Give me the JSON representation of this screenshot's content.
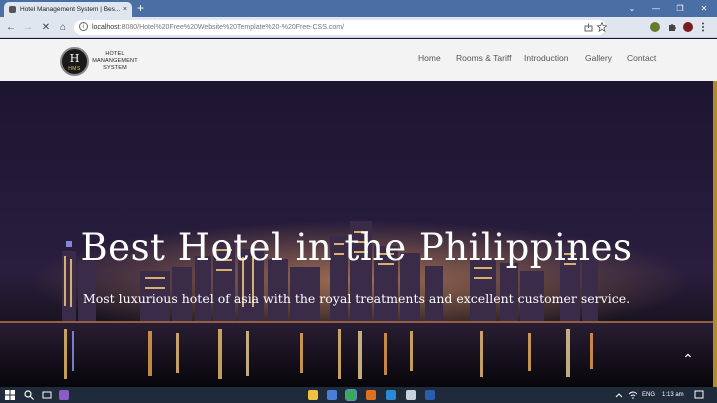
{
  "browser": {
    "tab_title": "Hotel Management System | Bes...",
    "tab_close": "×",
    "new_tab": "+",
    "url_host": "localhost",
    "url_rest": ":8080/Hotel%20Free%20Website%20Template%20-%20Free-CSS.com/",
    "back": "←",
    "forward": "→",
    "reload": "✕",
    "home": "⌂",
    "minimize": "—",
    "maximize": "❐",
    "close": "✕",
    "dropdown": "⌄",
    "info": "i"
  },
  "site": {
    "logo_letter": "H",
    "logo_sub": "HMS",
    "logo_text_line1": "HOTEL",
    "logo_text_line2": "MANANGEMENT",
    "logo_text_line3": "SYSTEM",
    "nav": {
      "home": "Home",
      "rooms": "Rooms & Tariff",
      "intro": "Introduction",
      "gallery": "Gallery",
      "contact": "Contact"
    },
    "hero_title": "Best Hotel in the Philippines",
    "hero_subtitle": "Most luxurious hotel of asia with the royal treatments and excellent customer service.",
    "scroll_top": "⌃"
  },
  "taskbar": {
    "lang": "ENG",
    "time": "1:13 am"
  },
  "colors": {
    "chrome_frame": "#4a6fa5",
    "header_bg": "#f3f3f3",
    "hero_accent": "#b08a2e",
    "taskbar": "#1f2a3a"
  }
}
